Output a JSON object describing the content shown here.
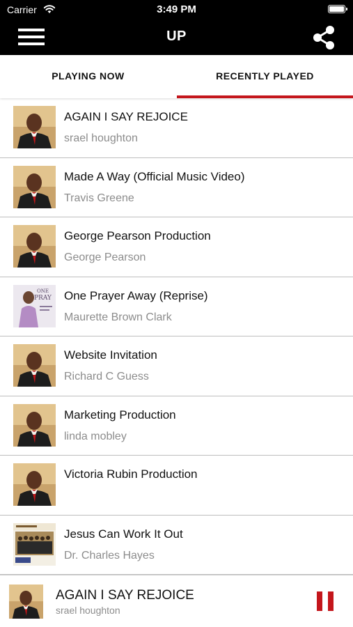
{
  "status_bar": {
    "carrier": "Carrier",
    "time": "3:49 PM"
  },
  "nav": {
    "title": "UP",
    "menu_icon": "hamburger-menu-icon",
    "share_icon": "share-icon"
  },
  "tabs": [
    {
      "label": "PLAYING NOW",
      "selected": false
    },
    {
      "label": "RECENTLY PLAYED",
      "selected": true
    }
  ],
  "colors": {
    "accent": "#c4161c",
    "bar": "#000000",
    "divider": "#bdbdbd",
    "subtitle": "#8c8c8c"
  },
  "tracks": [
    {
      "title": "AGAIN I SAY REJOICE",
      "artist": "srael houghton",
      "art": "portrait"
    },
    {
      "title": "Made A Way (Official Music Video)",
      "artist": "Travis Greene",
      "art": "portrait"
    },
    {
      "title": "George Pearson Production",
      "artist": "George Pearson",
      "art": "portrait"
    },
    {
      "title": "One Prayer Away (Reprise)",
      "artist": "Maurette Brown Clark",
      "art": "album-lavender"
    },
    {
      "title": "Website Invitation",
      "artist": "Richard C Guess",
      "art": "portrait"
    },
    {
      "title": "Marketing Production",
      "artist": "linda mobley",
      "art": "portrait"
    },
    {
      "title": "Victoria Rubin Production",
      "artist": "",
      "art": "portrait"
    },
    {
      "title": "Jesus Can Work It Out",
      "artist": "Dr. Charles Hayes",
      "art": "album-choir"
    }
  ],
  "now_playing": {
    "title": "AGAIN I SAY REJOICE",
    "artist": "srael houghton",
    "control_icon": "pause-icon"
  }
}
